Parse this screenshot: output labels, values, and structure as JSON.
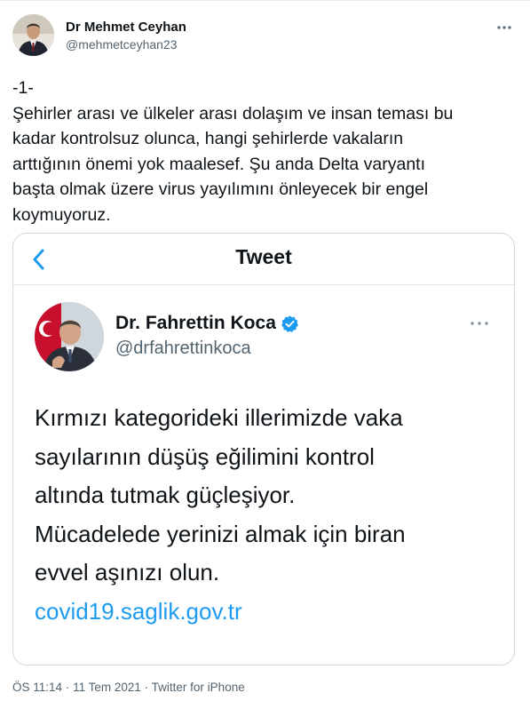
{
  "tweet": {
    "author_name": "Dr Mehmet Ceyhan",
    "author_handle": "@mehmetceyhan23",
    "more_icon": "more-horizontal-icon",
    "lines": [
      "-1-",
      "Şehirler arası ve ülkeler arası dolaşım ve insan teması bu",
      "kadar kontrolsuz olunca, hangi şehirlerde vakaların",
      "arttığının önemi yok maalesef. Şu anda Delta varyantı",
      "başta olmak üzere virus yayılımını önleyecek bir engel",
      "koymuyoruz."
    ],
    "time": "ÖS 11:14",
    "separator": "·",
    "date": "11 Tem 2021",
    "source": "Twitter for iPhone"
  },
  "embedded": {
    "nav_title": "Tweet",
    "back_icon": "chevron-left-icon",
    "author_name": "Dr. Fahrettin Koca",
    "verified_icon": "verified-badge-icon",
    "author_handle": "@drfahrettinkoca",
    "lines": [
      "Kırmızı kategorideki illerimizde vaka",
      "sayılarının düşüş eğilimini kontrol",
      "altında tutmak güçleşiyor.",
      "Mücadelede yerinizi almak için biran",
      "evvel aşınızı olun."
    ],
    "link": "covid19.saglik.gov.tr"
  },
  "colors": {
    "link": "#1d9bf0",
    "secondary_text": "#536471",
    "border": "#cfd9de"
  }
}
